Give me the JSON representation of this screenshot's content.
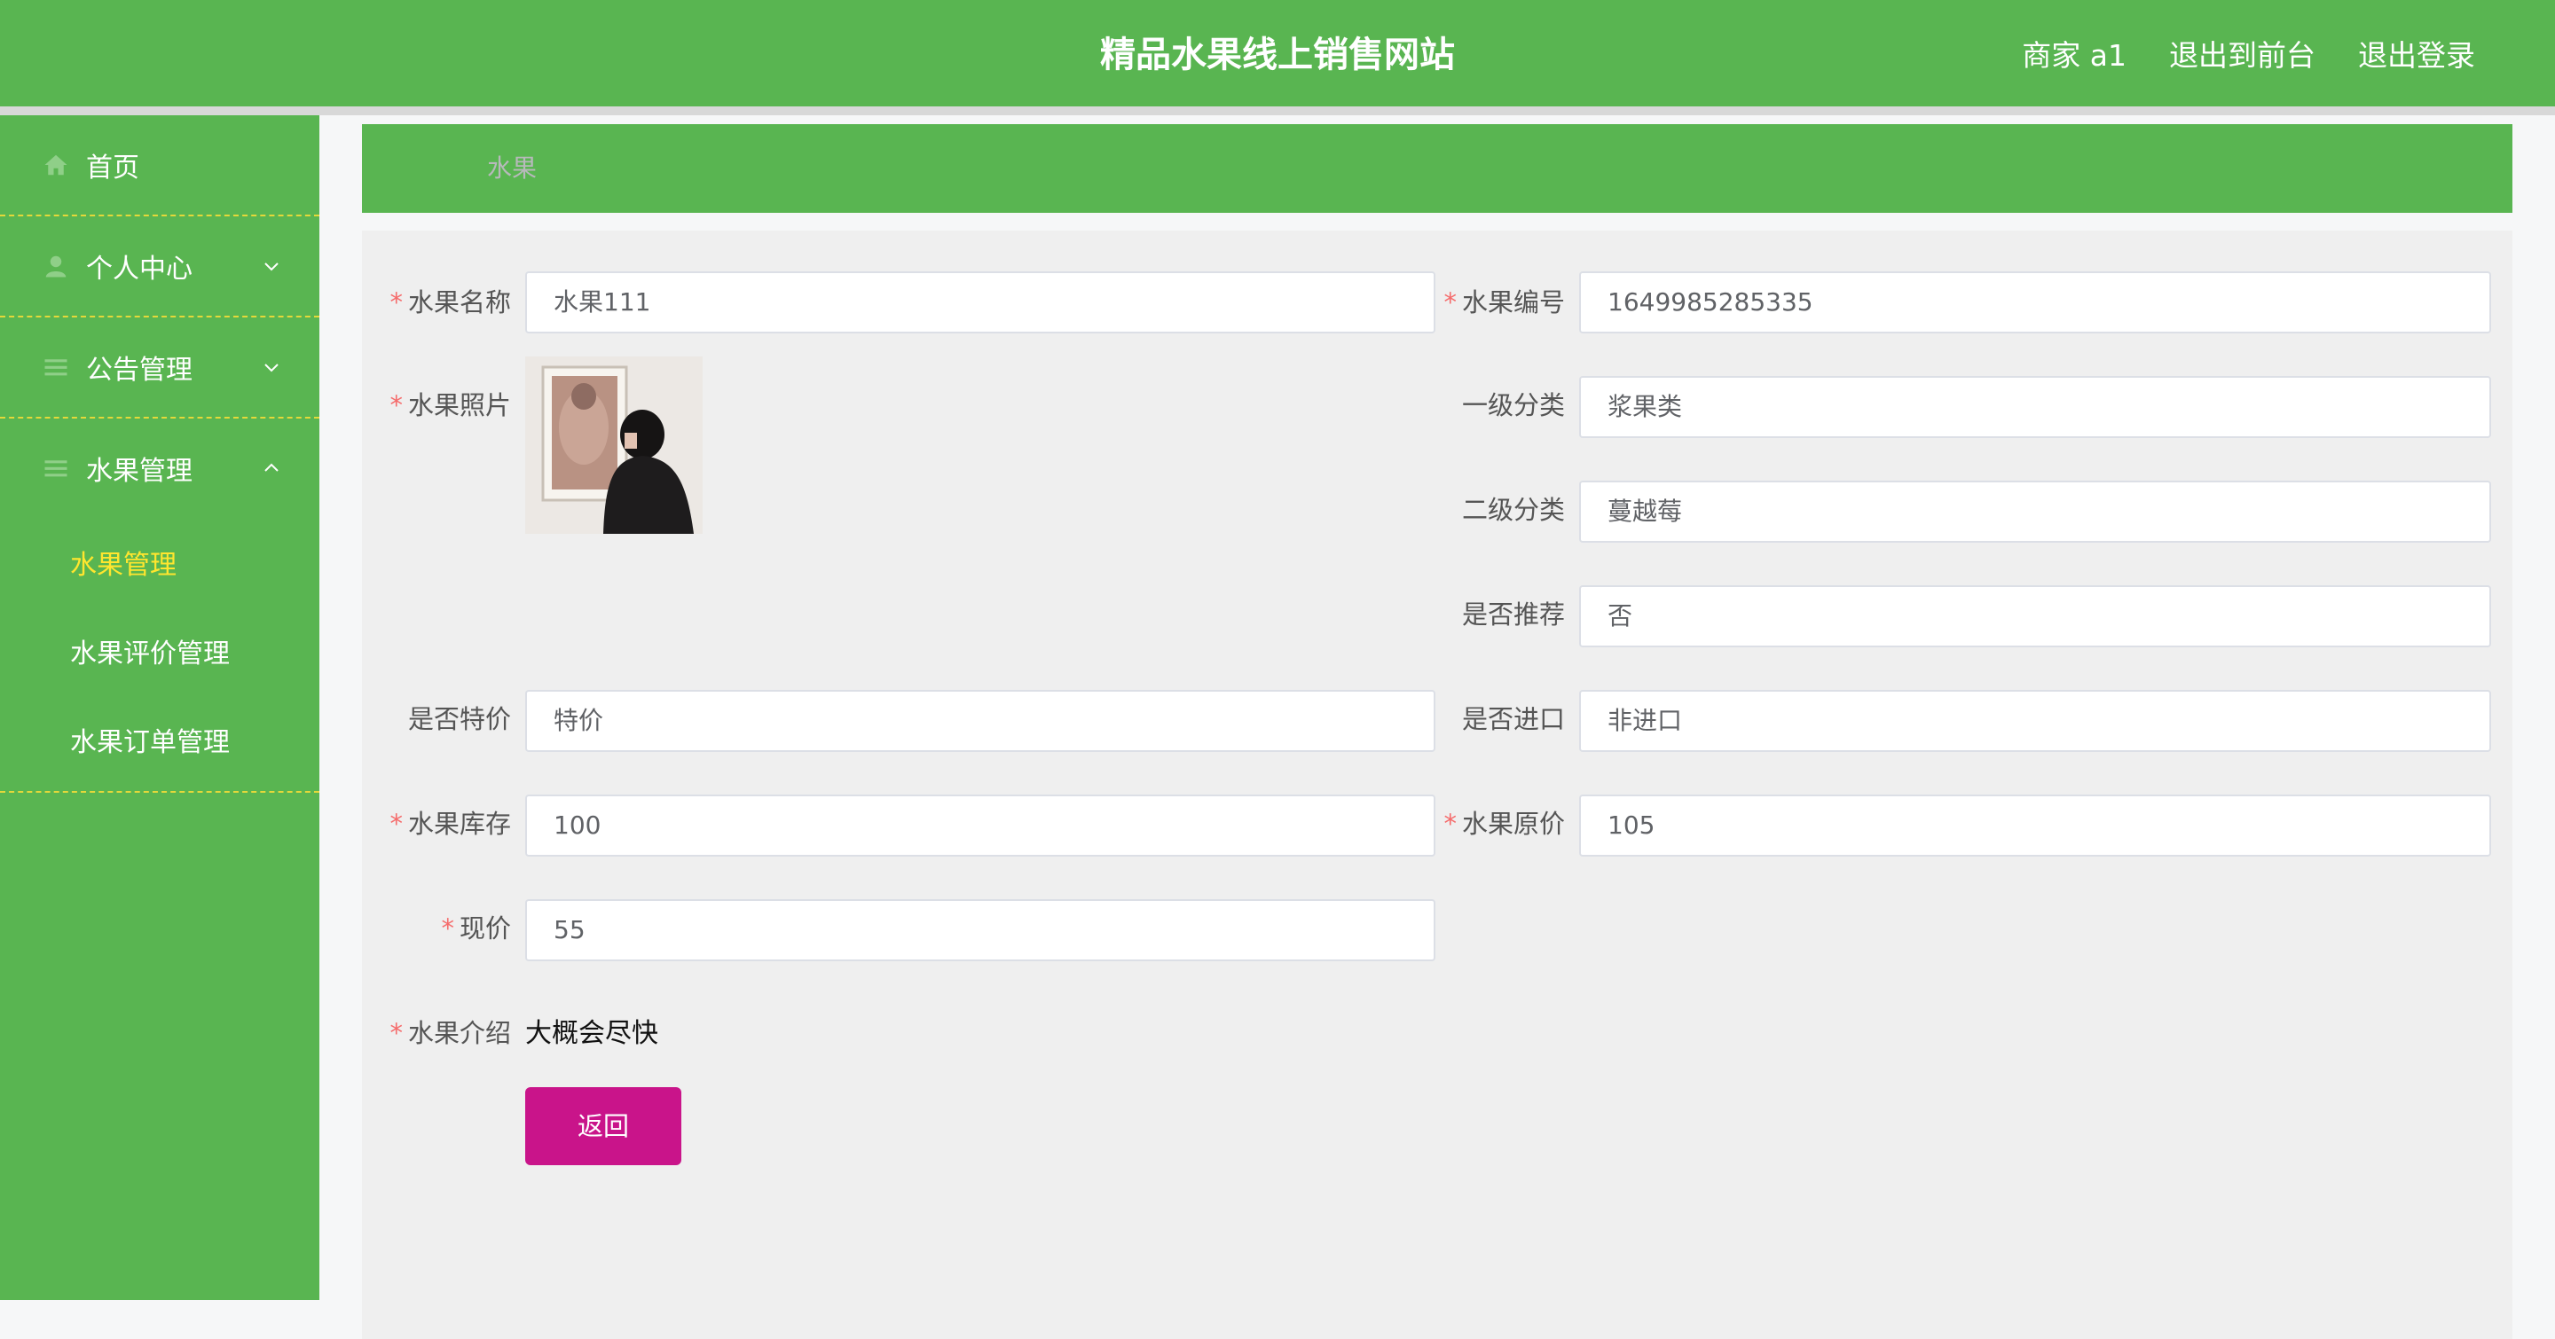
{
  "header": {
    "site_title": "精品水果线上销售网站",
    "user_label": "商家 a1",
    "to_front_label": "退出到前台",
    "logout_label": "退出登录"
  },
  "sidebar": {
    "items": [
      {
        "label": "首页",
        "icon": "home-icon"
      },
      {
        "label": "个人中心",
        "icon": "user-icon",
        "expanded": false
      },
      {
        "label": "公告管理",
        "icon": "list-icon",
        "expanded": false
      },
      {
        "label": "水果管理",
        "icon": "list-icon",
        "expanded": true
      }
    ],
    "subitems": [
      {
        "label": "水果管理",
        "active": true
      },
      {
        "label": "水果评价管理",
        "active": false
      },
      {
        "label": "水果订单管理",
        "active": false
      }
    ]
  },
  "breadcrumb": {
    "label": "水果"
  },
  "form": {
    "name": {
      "label": "水果名称",
      "value": "水果111",
      "required": true
    },
    "code": {
      "label": "水果编号",
      "value": "1649985285335",
      "required": true
    },
    "photo": {
      "label": "水果照片",
      "required": true
    },
    "category1": {
      "label": "一级分类",
      "value": "浆果类"
    },
    "category2": {
      "label": "二级分类",
      "value": "蔓越莓"
    },
    "recommend": {
      "label": "是否推荐",
      "value": "否"
    },
    "special": {
      "label": "是否特价",
      "value": "特价"
    },
    "imported": {
      "label": "是否进口",
      "value": "非进口"
    },
    "stock": {
      "label": "水果库存",
      "value": "100",
      "required": true
    },
    "original_price": {
      "label": "水果原价",
      "value": "105",
      "required": true
    },
    "current_price": {
      "label": "现价",
      "value": "55",
      "required": true
    },
    "intro": {
      "label": "水果介绍",
      "value": "大概会尽快",
      "required": true
    },
    "back_label": "返回"
  },
  "colors": {
    "primary_green": "#59b551",
    "active_submenu": "#ffe62e",
    "back_button": "#c9148a",
    "required_star": "#f56c6c"
  }
}
